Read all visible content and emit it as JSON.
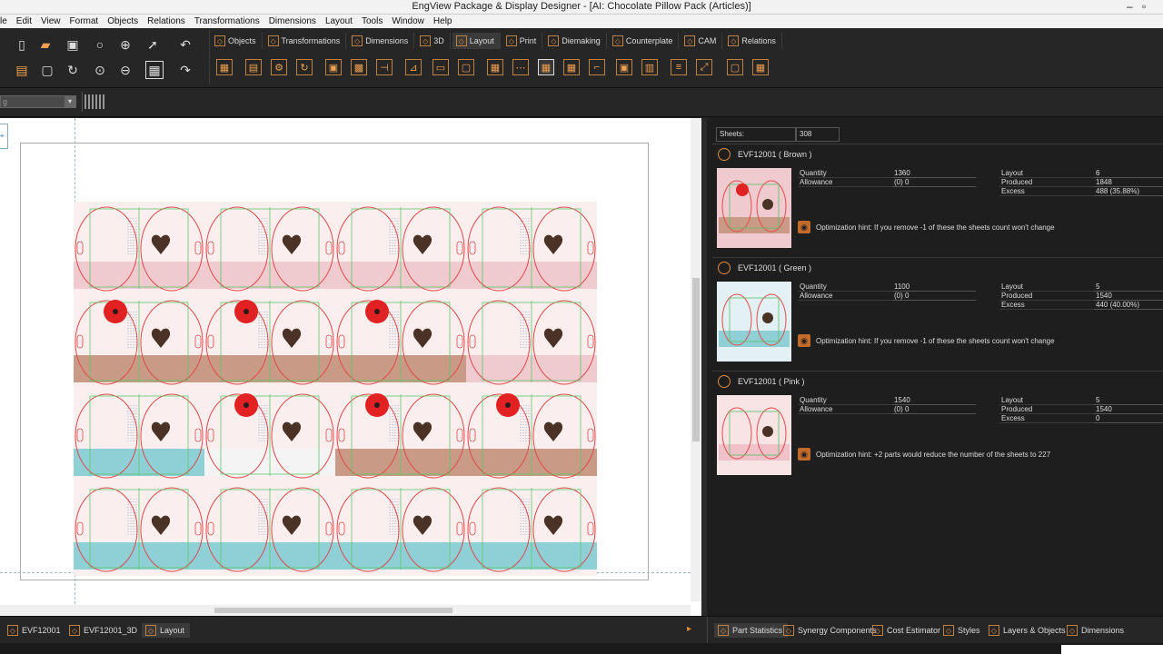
{
  "window": {
    "title": "EngView Package & Display Designer - [AI: Chocolate Pillow Pack (Articles)]",
    "controls": [
      "–",
      "▫",
      "✕"
    ]
  },
  "menu": [
    "le",
    "Edit",
    "View",
    "Format",
    "Objects",
    "Relations",
    "Transformations",
    "Dimensions",
    "Layout",
    "Tools",
    "Window",
    "Help"
  ],
  "tabs": [
    {
      "label": "Objects",
      "icon": "objects-icon"
    },
    {
      "label": "Transformations",
      "icon": "transform-icon"
    },
    {
      "label": "Dimensions",
      "icon": "dimensions-icon"
    },
    {
      "label": "3D",
      "icon": "3d-icon"
    },
    {
      "label": "Layout",
      "icon": "layout-icon",
      "active": true
    },
    {
      "label": "Print",
      "icon": "print-icon"
    },
    {
      "label": "Diemaking",
      "icon": "diemaking-icon"
    },
    {
      "label": "Counterplate",
      "icon": "counterplate-icon"
    },
    {
      "label": "CAM",
      "icon": "cam-icon"
    },
    {
      "label": "Relations",
      "icon": "relations-icon"
    }
  ],
  "row2": {
    "combo_value": "g"
  },
  "panel": {
    "sheets_label": "Sheets:",
    "sheets_value": "308",
    "items": [
      {
        "name": "EVF12001 ( Brown )",
        "quantity_label": "Quantity",
        "quantity": "1360",
        "allowance_label": "Allowance",
        "allowance": "(0) 0",
        "layout_label": "Layout",
        "layout": "6",
        "produced_label": "Produced",
        "produced": "1848",
        "excess_label": "Excess",
        "excess": "488 (35.88%)",
        "hint": "Optimization hint: If you remove -1 of these the sheets count won't change",
        "bottom_color": "#c99b86",
        "top_color": "#efcbd0"
      },
      {
        "name": "EVF12001 ( Green )",
        "quantity_label": "Quantity",
        "quantity": "1100",
        "allowance_label": "Allowance",
        "allowance": "(0) 0",
        "layout_label": "Layout",
        "layout": "5",
        "produced_label": "Produced",
        "produced": "1540",
        "excess_label": "Excess",
        "excess": "440 (40.00%)",
        "hint": "Optimization hint: If you remove -1 of these the sheets count won't change",
        "bottom_color": "#8fd0d6",
        "top_color": "#e3f1f4"
      },
      {
        "name": "EVF12001 ( Pink )",
        "quantity_label": "Quantity",
        "quantity": "1540",
        "allowance_label": "Allowance",
        "allowance": "(0) 0",
        "layout_label": "Layout",
        "layout": "5",
        "produced_label": "Produced",
        "produced": "1540",
        "excess_label": "Excess",
        "excess": "0",
        "hint": "Optimization hint: +2 parts would reduce the number of the sheets to 227",
        "bottom_color": "#f0c1c8",
        "top_color": "#f8e4e4"
      }
    ]
  },
  "bottom_tabs_left": [
    {
      "label": "EVF12001",
      "icon": "part-icon"
    },
    {
      "label": "EVF12001_3D",
      "icon": "3d-part-icon"
    },
    {
      "label": "Layout",
      "icon": "layout-icon",
      "active": true
    }
  ],
  "bottom_tabs_right": [
    {
      "label": "Part Statistics",
      "icon": "statistics-icon",
      "active": true
    },
    {
      "label": "Synergy Components",
      "icon": "synergy-icon"
    },
    {
      "label": "Cost Estimator",
      "icon": "cost-icon"
    },
    {
      "label": "Styles",
      "icon": "styles-icon"
    },
    {
      "label": "Layers & Objects",
      "icon": "layers-icon"
    },
    {
      "label": "Dimensions",
      "icon": "dimensions-icon"
    }
  ],
  "layout_rows": [
    [
      "#efcbd0",
      "#efcbd0",
      "#efcbd0",
      "#efcbd0"
    ],
    [
      "#c99b86",
      "#c99b86",
      "#c99b86",
      "#efcbd0"
    ],
    [
      "#8fd0d6",
      "#f4f4f4",
      "#c99b86",
      "#c99b86"
    ],
    [
      "#8fd0d6",
      "#8fd0d6",
      "#8fd0d6",
      "#8fd0d6"
    ]
  ],
  "poppy_cells": [
    [
      1,
      0
    ],
    [
      1,
      1
    ],
    [
      1,
      2
    ],
    [
      2,
      1
    ],
    [
      2,
      2
    ],
    [
      2,
      3
    ]
  ]
}
